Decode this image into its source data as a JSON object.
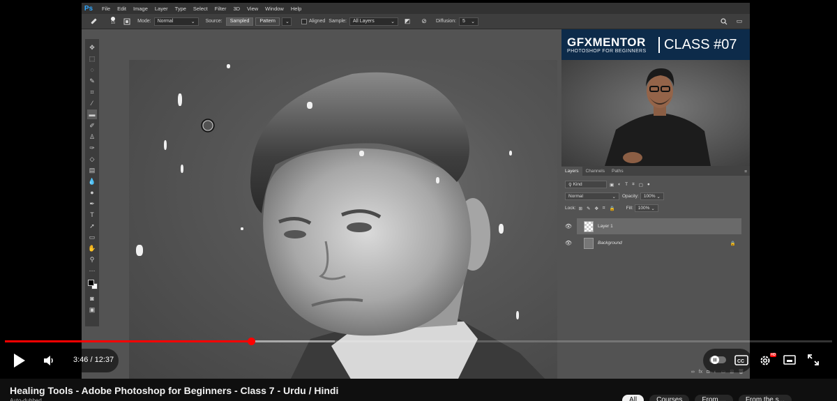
{
  "photoshop": {
    "logo": "Ps",
    "menu": [
      "File",
      "Edit",
      "Image",
      "Layer",
      "Type",
      "Select",
      "Filter",
      "3D",
      "View",
      "Window",
      "Help"
    ],
    "options": {
      "brush_size": "15",
      "mode_label": "Mode:",
      "mode_value": "Normal",
      "source_label": "Source:",
      "source_sampled": "Sampled",
      "source_pattern": "Pattern",
      "aligned_label": "Aligned",
      "sample_label": "Sample:",
      "sample_value": "All Layers",
      "diffusion_label": "Diffusion:",
      "diffusion_value": "5"
    },
    "layers_panel": {
      "tabs": [
        "Layers",
        "Channels",
        "Paths"
      ],
      "kind_label": "Kind",
      "blend_mode": "Normal",
      "opacity_label": "Opacity:",
      "opacity_value": "100%",
      "lock_label": "Lock:",
      "fill_label": "Fill:",
      "fill_value": "100%",
      "layers": [
        {
          "name": "Layer 1",
          "selected": true
        },
        {
          "name": "Background",
          "selected": false
        }
      ]
    }
  },
  "banner": {
    "brand": "GFXMENTOR",
    "tagline": "PHOTOSHOP FOR BEGINNERS",
    "class_label": "CLASS #07"
  },
  "player": {
    "current_time": "3:46",
    "duration": "12:37",
    "time_display": "3:46 / 12:37",
    "played_fraction": 0.298,
    "hd_badge": "HD"
  },
  "video": {
    "title": "Healing Tools - Adobe Photoshop for Beginners - Class 7 - Urdu / Hindi",
    "subtitle": "Auto-dubbed"
  },
  "chips": [
    "All",
    "Courses",
    "From ...",
    "From the s..."
  ],
  "colors": {
    "progress": "#ff0000",
    "ps_accent": "#31a8ff",
    "banner_bg": "#0d2b4a"
  }
}
